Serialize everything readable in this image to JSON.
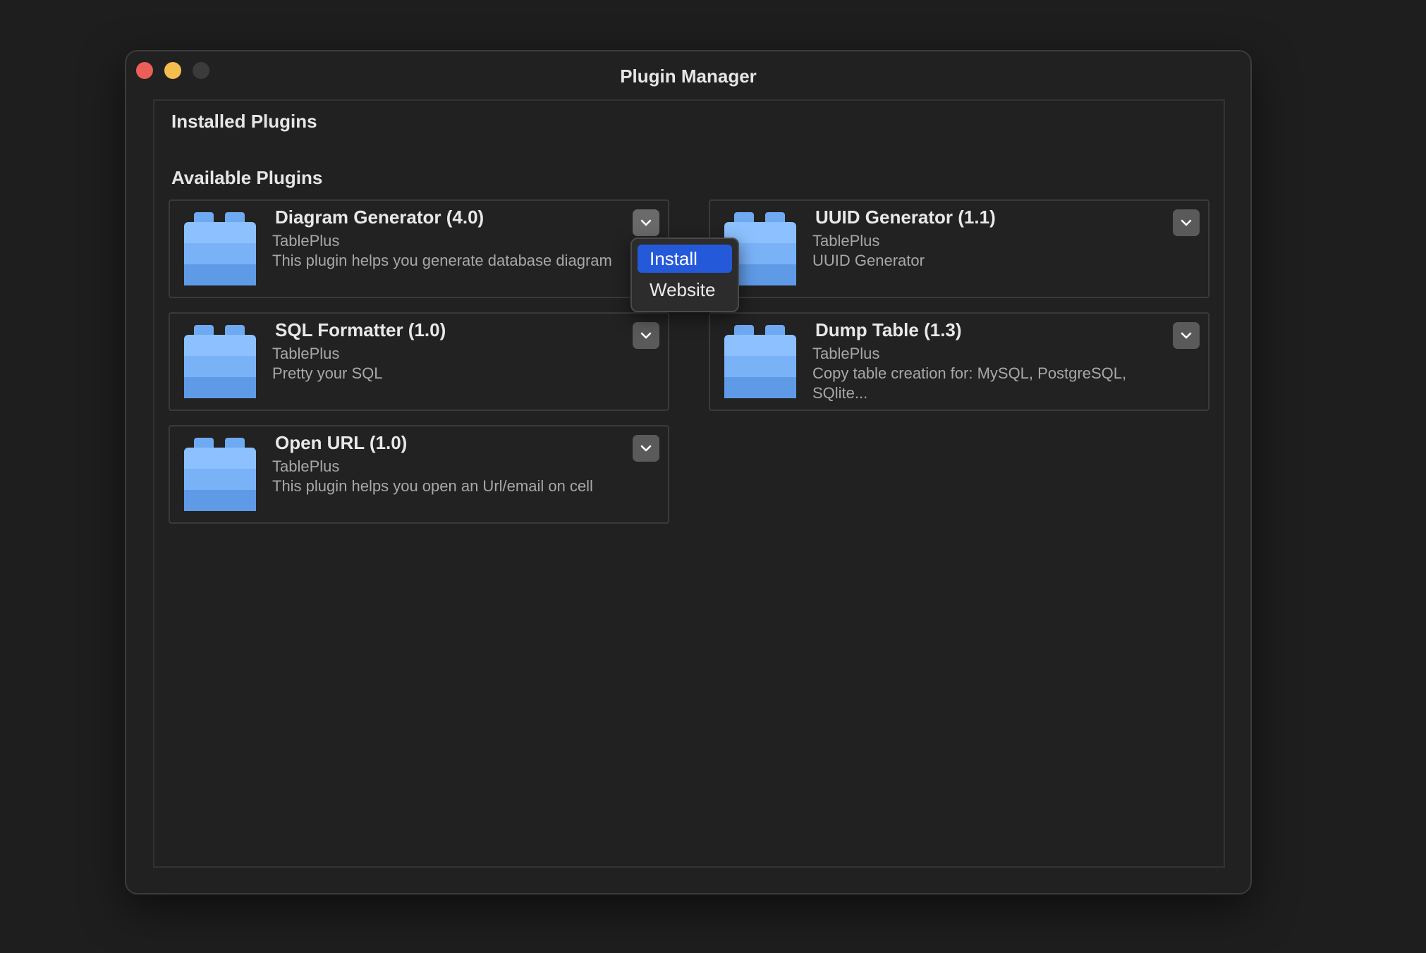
{
  "window": {
    "title": "Plugin Manager"
  },
  "sections": {
    "installed_title": "Installed Plugins",
    "available_title": "Available Plugins"
  },
  "plugins": [
    {
      "name": "Diagram Generator (4.0)",
      "author": "TablePlus",
      "description": "This plugin helps you generate database diagram"
    },
    {
      "name": "UUID Generator (1.1)",
      "author": "TablePlus",
      "description": "UUID Generator"
    },
    {
      "name": "SQL Formatter (1.0)",
      "author": "TablePlus",
      "description": "Pretty your SQL"
    },
    {
      "name": "Dump Table (1.3)",
      "author": "TablePlus",
      "description": "Copy table creation for: MySQL, PostgreSQL, SQlite..."
    },
    {
      "name": "Open URL (1.0)",
      "author": "TablePlus",
      "description": "This plugin helps you open an Url/email on cell"
    }
  ],
  "context_menu": {
    "items": [
      {
        "label": "Install",
        "selected": true
      },
      {
        "label": "Website",
        "selected": false
      }
    ]
  },
  "colors": {
    "accent": "#2459d9",
    "icon_light": "#8cc0ff",
    "icon_dark": "#5f9ae6",
    "close": "#ec5f58",
    "minimize": "#f5bd4f"
  },
  "icons": {
    "plugin": "lego-brick-icon",
    "menu": "chevron-down-icon"
  }
}
